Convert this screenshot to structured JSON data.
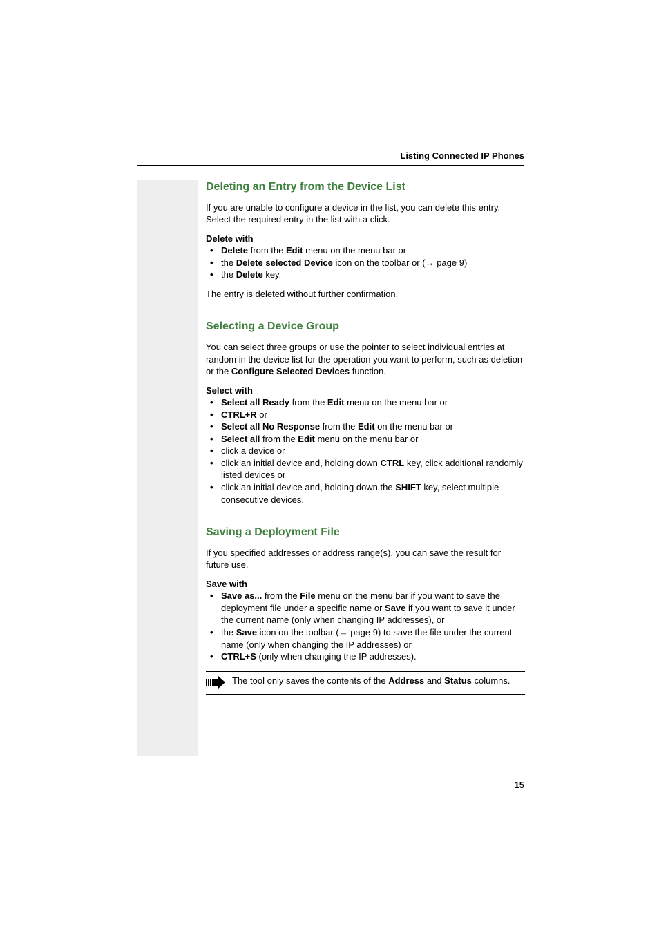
{
  "header": {
    "title": "Listing Connected IP Phones"
  },
  "sections": {
    "deleting": {
      "heading": "Deleting an Entry from the Device List",
      "intro": "If you are unable to configure a device in the list, you can delete this entry. Select the required entry in the list with a click.",
      "subhead": "Delete with",
      "bullet1_pre": "Delete",
      "bullet1_post": " from the ",
      "bullet1_b2": "Edit",
      "bullet1_tail": " menu on the menu bar or",
      "bullet2_pre": "the ",
      "bullet2_b": "Delete selected Device",
      "bullet2_mid": " icon on the toolbar or (",
      "bullet2_ref": " page 9)",
      "bullet3_pre": "the ",
      "bullet3_b": "Delete",
      "bullet3_tail": " key.",
      "outro": "The entry is deleted without further confirmation."
    },
    "selecting": {
      "heading": "Selecting a Device Group",
      "intro_a": "You can select three groups or use the pointer to select individual entries at random in the device list for the operation you want to perform, such as deletion or the  ",
      "intro_b": "Configure Selected Devices",
      "intro_c": " function.",
      "subhead": "Select with",
      "b1_a": "Select all Ready",
      "b1_b": " from the ",
      "b1_c": "Edit",
      "b1_d": " menu on the menu bar or",
      "b2_a": "CTRL+R",
      "b2_b": " or",
      "b3_a": "Select all No Response",
      "b3_b": " from the ",
      "b3_c": "Edit",
      "b3_d": " on the menu bar or",
      "b4_a": "Select all",
      "b4_b": " from the ",
      "b4_c": "Edit",
      "b4_d": " menu on the menu bar or",
      "b5": "click a device or",
      "b6_a": "click an initial device and, holding down ",
      "b6_b": "CTRL",
      "b6_c": " key, click additional randomly listed devices or",
      "b7_a": "click an initial device and, holding down the ",
      "b7_b": "SHIFT",
      "b7_c": " key, select multiple consecutive devices."
    },
    "saving": {
      "heading": "Saving a Deployment File",
      "intro": "If you specified addresses or address range(s), you can save the result for future use.",
      "subhead": "Save with",
      "b1_a": "Save as...",
      "b1_b": " from the ",
      "b1_c": "File",
      "b1_d": " menu on the menu bar if you want to save the deployment file under a specific name or ",
      "b1_e": "Save",
      "b1_f": " if you want to save it under the current name (only when changing IP addresses), or",
      "b2_a": "the ",
      "b2_b": "Save",
      "b2_c": " icon on the toolbar (",
      "b2_ref": " page 9) to save the file under the current name (only when changing the IP addresses) or",
      "b3_a": "CTRL+S",
      "b3_b": " (only when changing the IP addresses).",
      "note_a": "The tool only saves the contents of the ",
      "note_b": "Address",
      "note_c": " and ",
      "note_d": "Status",
      "note_e": " columns."
    }
  },
  "pageNumber": "15",
  "glyphs": {
    "arrow": "→"
  }
}
